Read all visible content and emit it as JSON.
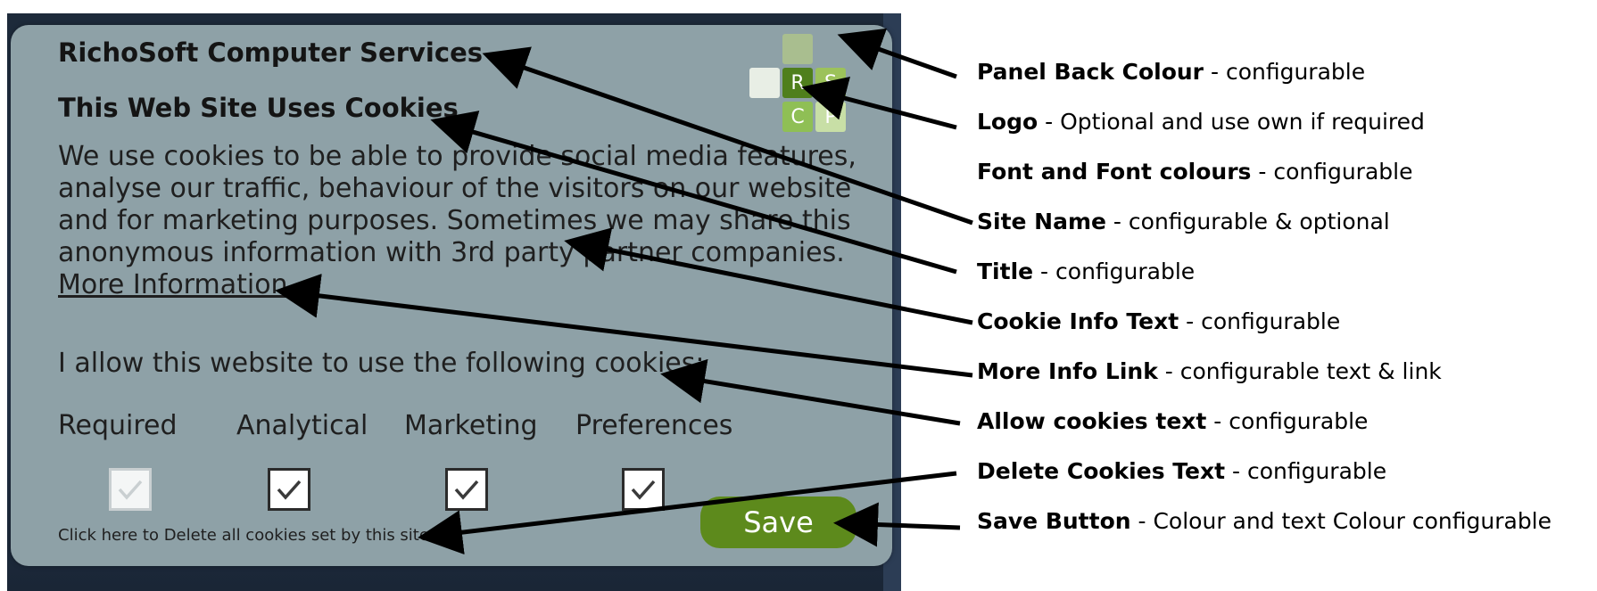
{
  "panel": {
    "site_name": "RichoSoft Computer Services",
    "title": "This Web Site Uses Cookies",
    "info_lines": [
      "We use cookies to be able to provide social media features,",
      "analyse our traffic, behaviour of the visitors on our website",
      "and for marketing purposes. Sometimes we may share this",
      "anonymous information with 3rd party partner companies."
    ],
    "more_info_link": "More Information",
    "allow_text": "I allow this website to use the following cookies:",
    "categories": [
      {
        "label": "Required",
        "checked": true,
        "disabled": true
      },
      {
        "label": "Analytical",
        "checked": true,
        "disabled": false
      },
      {
        "label": "Marketing",
        "checked": true,
        "disabled": false
      },
      {
        "label": "Preferences",
        "checked": true,
        "disabled": false
      }
    ],
    "delete_text": "Click here to Delete all cookies set by this site",
    "save_button": "Save",
    "logo": {
      "letters": [
        "R",
        "S",
        "C",
        "P"
      ]
    }
  },
  "annotations": [
    {
      "key": "Panel Back Colour",
      "desc": " - configurable"
    },
    {
      "key": "Logo",
      "desc": " - Optional and use own if required"
    },
    {
      "key": "Font and Font colours",
      "desc": " - configurable"
    },
    {
      "key": "Site Name",
      "desc": " - configurable & optional"
    },
    {
      "key": "Title",
      "desc": " - configurable"
    },
    {
      "key": "Cookie Info Text",
      "desc": " - configurable"
    },
    {
      "key": "More Info Link",
      "desc": " - configurable text & link"
    },
    {
      "key": "Allow cookies text",
      "desc": " - configurable"
    },
    {
      "key": "Delete Cookies Text",
      "desc": " - configurable"
    },
    {
      "key": "Save Button",
      "desc": " - Colour and text Colour configurable"
    }
  ],
  "colors": {
    "panel_background": "#8ea1a7",
    "save_button": "#5d8a1c",
    "logo_dark": "#4f7f1c",
    "logo_light": "#9cc25a",
    "logo_pale": "#c8dfa6"
  }
}
